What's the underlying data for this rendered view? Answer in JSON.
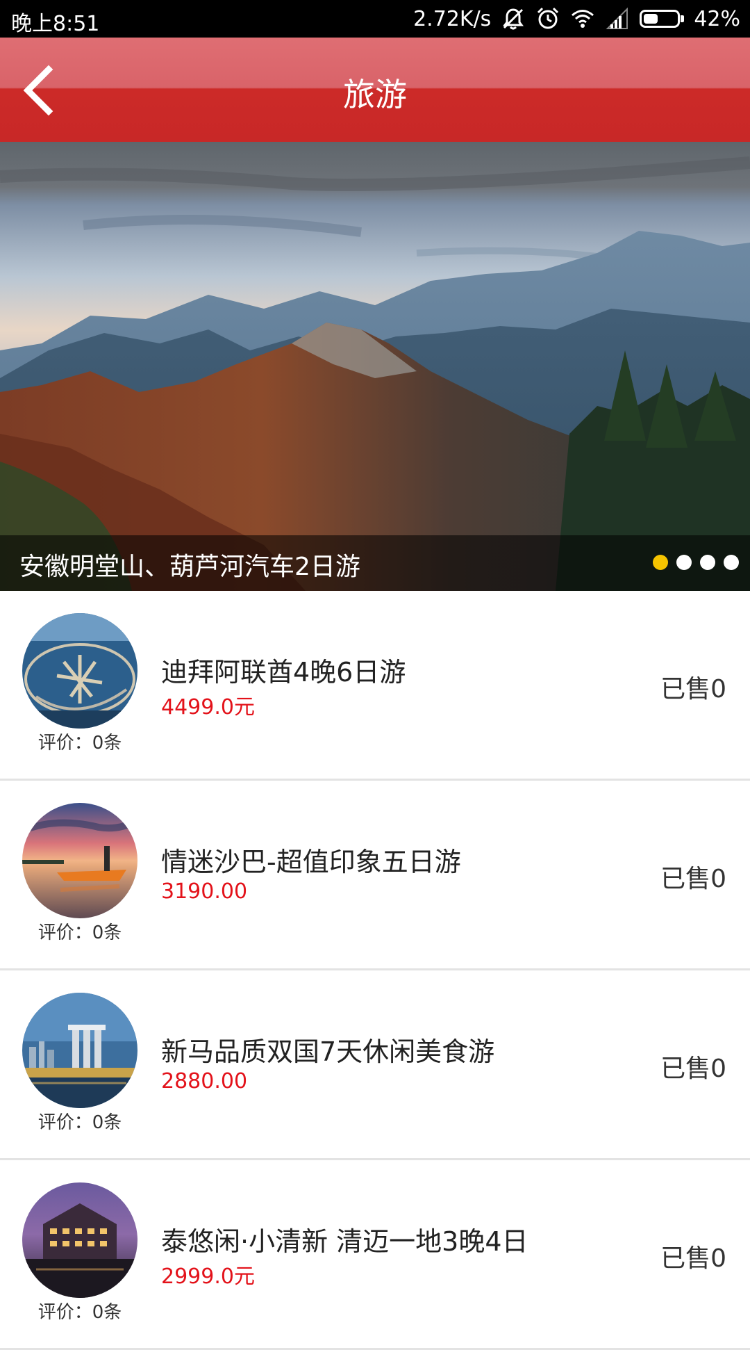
{
  "status_bar": {
    "time": "晚上8:51",
    "net_speed": "2.72K/s",
    "battery": "42%",
    "battery_level": 0.42,
    "icons": [
      "bell-off-icon",
      "alarm-icon",
      "wifi-icon",
      "signal-icon",
      "battery-icon"
    ]
  },
  "header": {
    "title": "旅游",
    "back_icon": "chevron-left-icon"
  },
  "banner": {
    "caption": "安徽明堂山、葫芦河汽车2日游",
    "slide_count": 4,
    "active_slide": 1
  },
  "list": {
    "items": [
      {
        "title": "迪拜阿联酋4晚6日游",
        "price": "4499.0元",
        "sold": "已售0",
        "rating": "评价：0条"
      },
      {
        "title": "情迷沙巴-超值印象五日游",
        "price": "3190.00",
        "sold": "已售0",
        "rating": "评价：0条"
      },
      {
        "title": "新马品质双国7天休闲美食游",
        "price": "2880.00",
        "sold": "已售0",
        "rating": "评价：0条"
      },
      {
        "title": "泰悠闲·小清新 清迈一地3晚4日",
        "price": "2999.0元",
        "sold": "已售0",
        "rating": "评价：0条"
      }
    ]
  },
  "colors": {
    "header_red": "#cc2a28",
    "price_red": "#e3121a",
    "active_dot": "#f5c400"
  }
}
